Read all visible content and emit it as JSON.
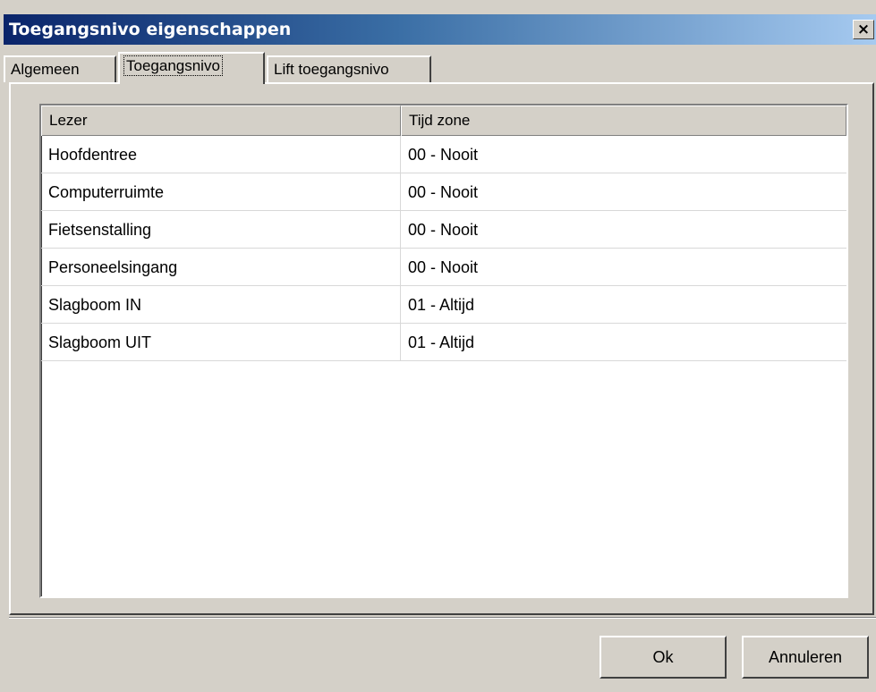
{
  "window": {
    "title": "Toegangsnivo eigenschappen",
    "close_label": "×"
  },
  "tabs": [
    {
      "label": "Algemeen",
      "active": false
    },
    {
      "label": "Toegangsnivo",
      "active": true
    },
    {
      "label": "Lift toegangsnivo",
      "active": false
    }
  ],
  "table": {
    "columns": [
      "Lezer",
      "Tijd zone"
    ],
    "rows": [
      [
        "Hoofdentree",
        "00 - Nooit"
      ],
      [
        "Computerruimte",
        "00 - Nooit"
      ],
      [
        "Fietsenstalling",
        "00 - Nooit"
      ],
      [
        "Personeelsingang",
        "00 - Nooit"
      ],
      [
        "Slagboom IN",
        "01 - Altijd"
      ],
      [
        "Slagboom UIT",
        "01 - Altijd"
      ]
    ]
  },
  "buttons": {
    "ok": "Ok",
    "cancel": "Annuleren"
  }
}
